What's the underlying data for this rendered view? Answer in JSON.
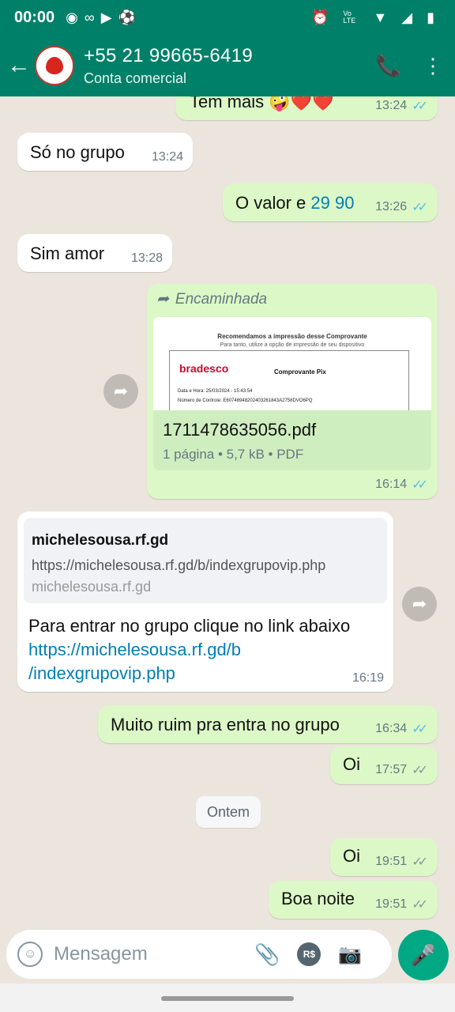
{
  "status": {
    "time": "00:00",
    "icons": [
      "chrome-icon",
      "voicemail-icon",
      "youtube-icon",
      "soccer-icon",
      "alarm-icon",
      "volte-icon",
      "wifi-icon",
      "signal-icon",
      "battery-icon"
    ],
    "volte": "Vo LTE"
  },
  "header": {
    "contact": "+55 21 99665-6419",
    "subtitle": "Conta comercial"
  },
  "messages": {
    "m0": {
      "text": "Tem mais 🤪❤️❤️",
      "time": "13:24"
    },
    "m1": {
      "text": "Só no grupo",
      "time": "13:24"
    },
    "m2": {
      "text_a": "O valor e ",
      "text_b": "29 90",
      "time": "13:26"
    },
    "m3": {
      "text": "Sim amor",
      "time": "13:28"
    },
    "m4": {
      "forwarded": "Encaminhada",
      "doc_title": "Recomendamos a impressão desse Comprovante",
      "doc_subtitle": "Para tanto, utilize a opção de impressão de seu dispositivo",
      "brand": "bradesco",
      "doc_type": "Comprovante Pix",
      "date_line": "Data e Hora:    25/03/2024 - 15:43:54",
      "control_line": "Número de Controle:   E60746948202403261843A2758DVO6PQ",
      "file_name": "1711478635056.pdf",
      "file_meta": "1 página • 5,7 kB • PDF",
      "time": "16:14"
    },
    "m5": {
      "link_title": "michelesousa.rf.gd",
      "link_url": "https://michelesousa.rf.gd/b/indexgrupovip.php",
      "link_domain": "michelesousa.rf.gd",
      "text": "Para entrar no grupo clique no link abaixo",
      "url_line1": "https://michelesousa.rf.gd/b",
      "url_line2": "/indexgrupovip.php",
      "time": "16:19"
    },
    "m6": {
      "text": "Muito ruim pra entra no grupo",
      "time": "16:34"
    },
    "m7": {
      "text": "Oi",
      "time": "17:57"
    },
    "date_divider": "Ontem",
    "m8": {
      "text": "Oi",
      "time": "19:51"
    },
    "m9": {
      "text": "Boa noite",
      "time": "19:51"
    }
  },
  "composer": {
    "placeholder": "Mensagem",
    "currency_label": "R$"
  },
  "colors": {
    "header": "#008069",
    "outgoing": "#DCF8C6",
    "incoming": "#FFFFFF",
    "read_tick": "#53bdeb",
    "mic": "#00a884"
  }
}
